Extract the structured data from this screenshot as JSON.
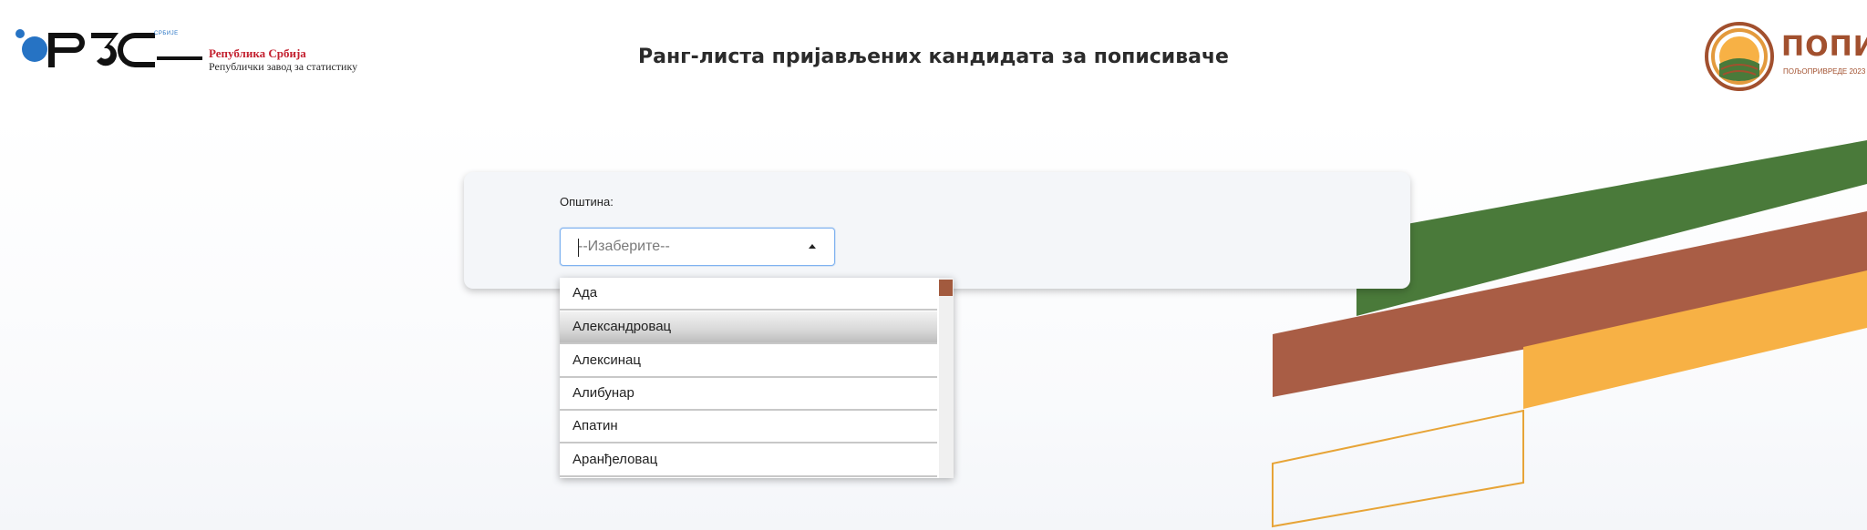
{
  "header": {
    "logo_tiny": "СРБИЈЕ",
    "logo_name": "Република Србија",
    "logo_subname": "Републички завод за статистику",
    "title": "Ранг-листа пријављених кандидата за пописиваче",
    "census_logo_text": "ПОПИС",
    "census_logo_sub": "ПОЉОПРИВРЕДЕ 2023"
  },
  "form": {
    "municipality_label": "Општина:",
    "select_value": "--Изаберите--",
    "options": [
      "Ада",
      "Александровац",
      "Алексинац",
      "Алибунар",
      "Апатин",
      "Аранђеловац"
    ],
    "hovered_option": "Александровац"
  },
  "colors": {
    "green_stripe": "#4a7a3a",
    "brown_stripe": "#a95d45",
    "orange_stripe": "#f7b145",
    "outline_stripe": "#e7a437",
    "brand_blue": "#2673c4",
    "brand_red": "#c3202f",
    "scroll_thumb": "#a25a3e"
  },
  "icons": {
    "select_arrow": "chevron-up-icon",
    "census_logo": "field-sun-icon"
  }
}
